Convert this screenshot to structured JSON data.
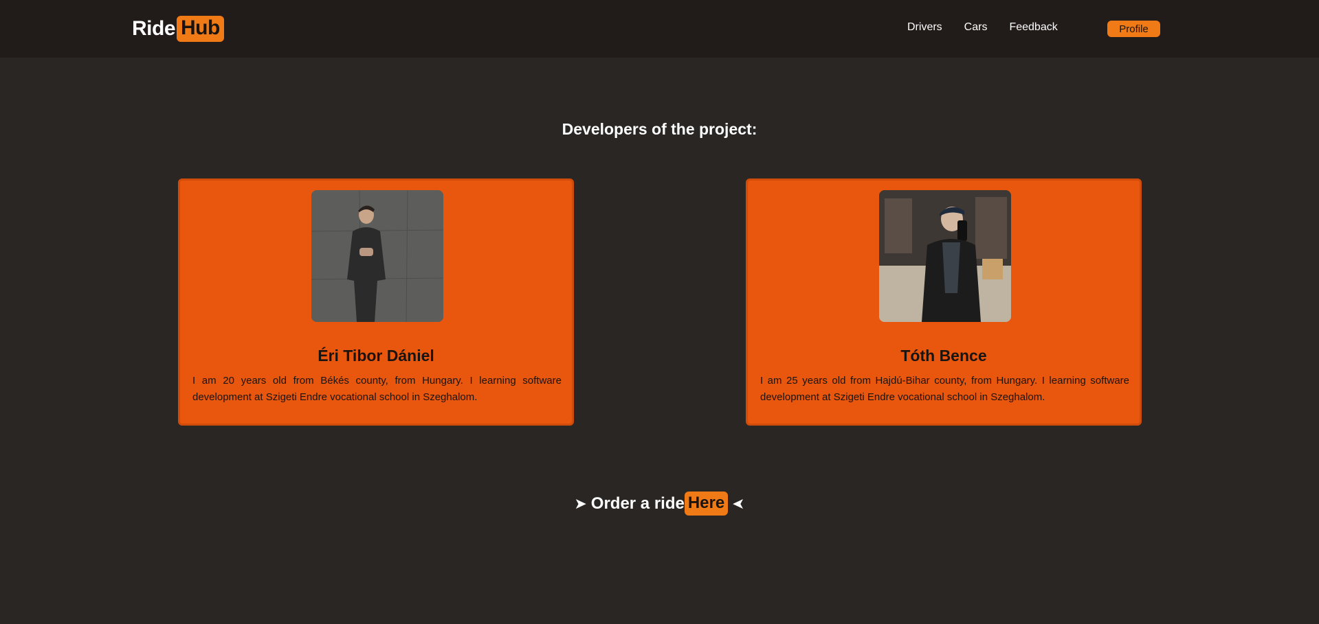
{
  "header": {
    "logo_part1": "Ride",
    "logo_part2": "Hub",
    "nav": [
      "Drivers",
      "Cars",
      "Feedback"
    ],
    "profile_label": "Profile"
  },
  "main": {
    "title": "Developers of the project:",
    "developers": [
      {
        "name": "Éri Tibor Dániel",
        "bio": "I am 20 years old from Békés county, from Hungary. I learning software development at Szigeti Endre vocational school in Szeghalom."
      },
      {
        "name": "Tóth Bence",
        "bio": "I am 25 years old from Hajdú-Bihar county, from Hungary. I learning software development at Szigeti Endre vocational school in Szeghalom."
      }
    ]
  },
  "cta": {
    "arrow_left": "➤",
    "text": "Order a ride",
    "link_label": "Here",
    "arrow_right": "➤"
  },
  "colors": {
    "accent": "#f07a16",
    "card_bg": "#e9560d",
    "page_bg": "#2a2624",
    "nav_bg": "#211b19"
  }
}
